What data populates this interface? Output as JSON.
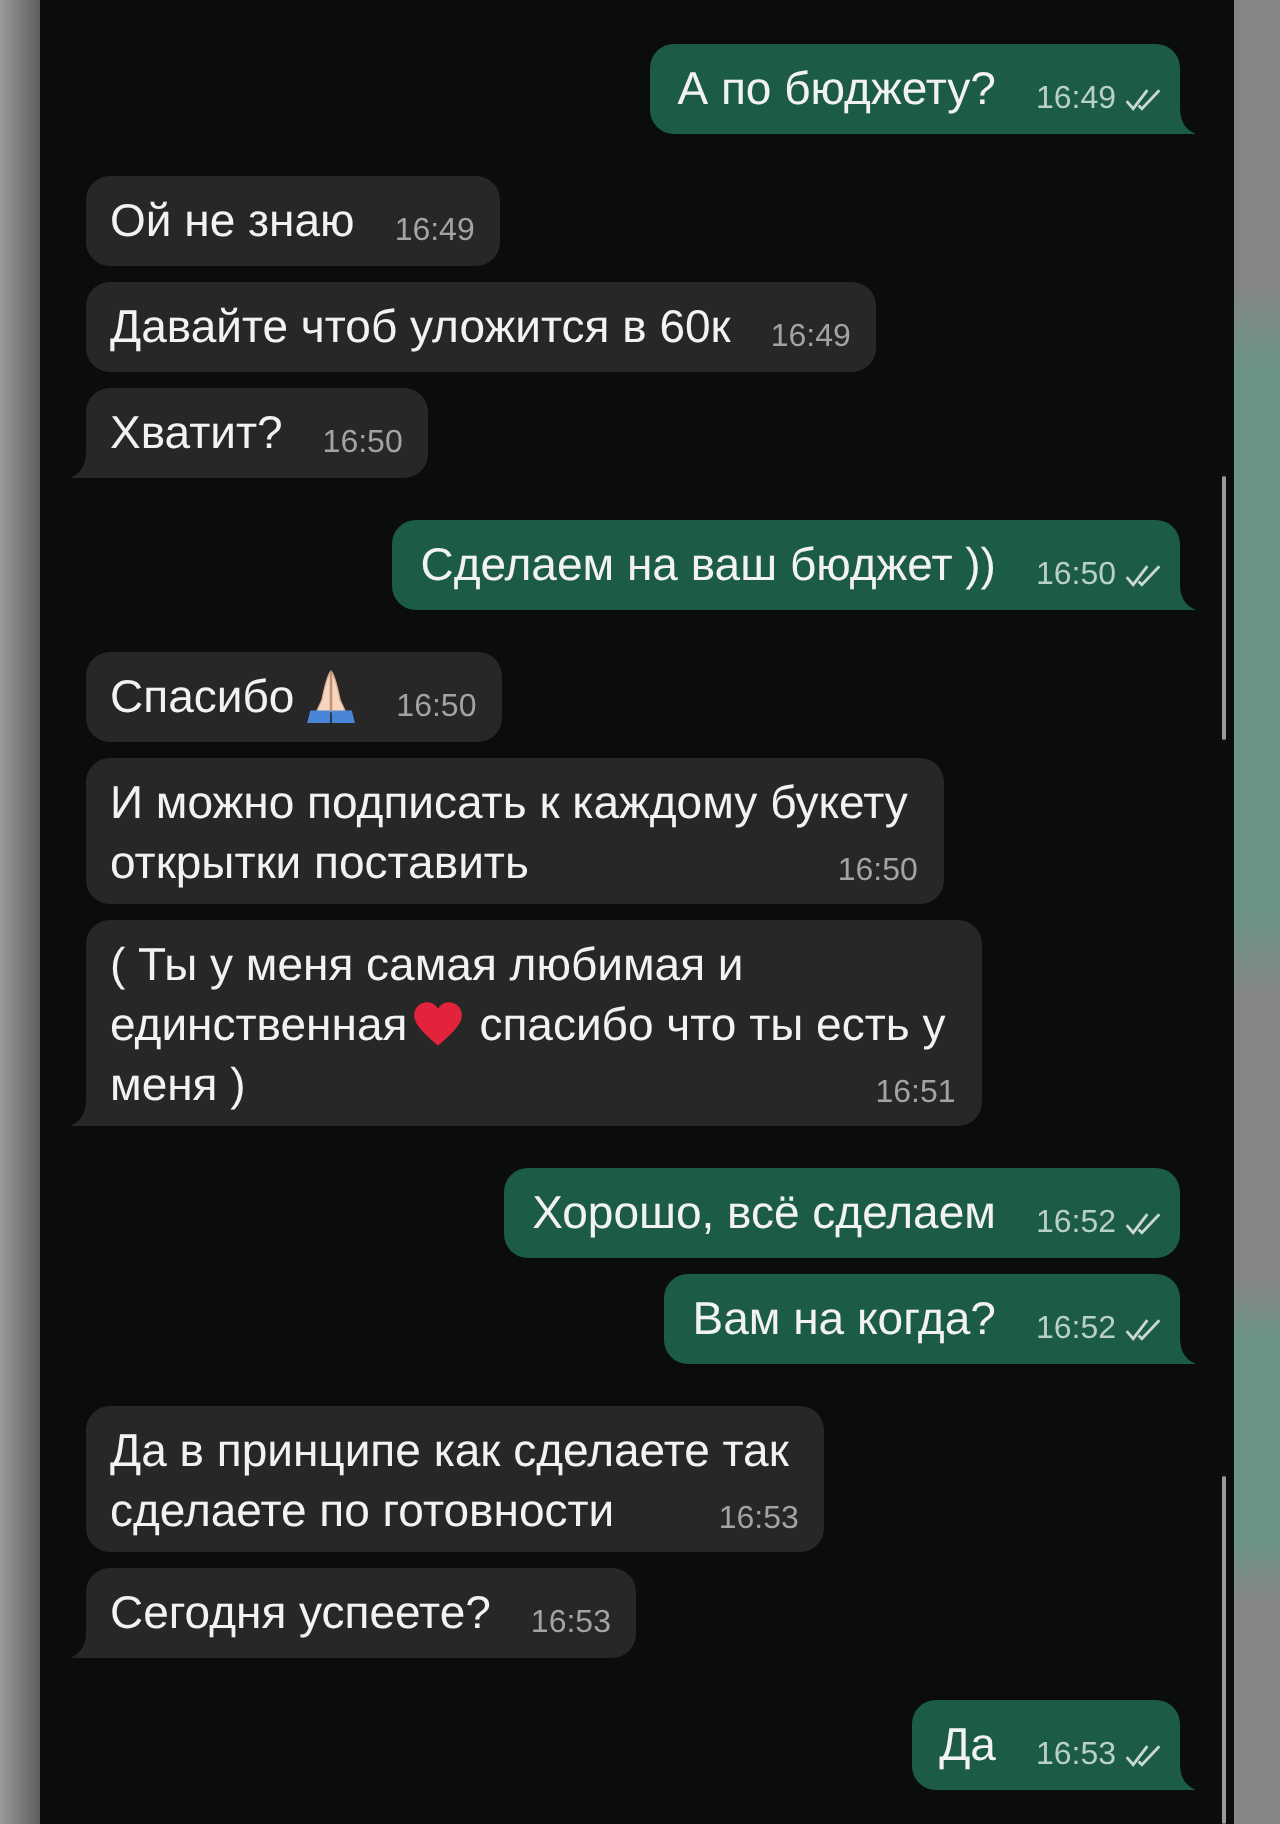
{
  "messages": [
    {
      "kind": "outgoing",
      "tail": true,
      "rows": [
        [
          {
            "kind": "text",
            "text": "А по бюджету?"
          }
        ]
      ],
      "time": "16:49",
      "read": false
    },
    {
      "kind": "incoming",
      "tail": false,
      "rows": [
        [
          {
            "kind": "text",
            "text": "Ой не знаю"
          }
        ]
      ],
      "time": "16:49"
    },
    {
      "kind": "incoming",
      "tail": false,
      "rows": [
        [
          {
            "kind": "text",
            "text": "Давайте чтоб уложится в 60к"
          }
        ]
      ],
      "time": "16:49"
    },
    {
      "kind": "incoming",
      "tail": true,
      "rows": [
        [
          {
            "kind": "text",
            "text": "Хватит?"
          }
        ]
      ],
      "time": "16:50"
    },
    {
      "kind": "outgoing",
      "tail": true,
      "rows": [
        [
          {
            "kind": "text",
            "text": "Сделаем на ваш бюджет ))"
          }
        ]
      ],
      "time": "16:50",
      "read": false
    },
    {
      "kind": "incoming",
      "tail": false,
      "rows": [
        [
          {
            "kind": "text",
            "text": "Спасибо"
          },
          {
            "kind": "pray"
          }
        ]
      ],
      "time": "16:50"
    },
    {
      "kind": "incoming",
      "tail": false,
      "rows": [
        [
          {
            "kind": "text",
            "text": "И можно подписать к каждому букету"
          }
        ],
        [
          {
            "kind": "text",
            "text": "открытки поставить"
          }
        ]
      ],
      "time": "16:50"
    },
    {
      "kind": "incoming",
      "tail": true,
      "rows": [
        [
          {
            "kind": "text",
            "text": "( Ты у меня самая любимая и"
          }
        ],
        [
          {
            "kind": "text",
            "text": "единственная"
          },
          {
            "kind": "heart"
          },
          {
            "kind": "text",
            "text": "спасибо что ты есть у"
          }
        ],
        [
          {
            "kind": "text",
            "text": "меня )"
          }
        ]
      ],
      "time": "16:51"
    },
    {
      "kind": "outgoing",
      "tail": false,
      "rows": [
        [
          {
            "kind": "text",
            "text": "Хорошо, всё сделаем"
          }
        ]
      ],
      "time": "16:52",
      "read": false
    },
    {
      "kind": "outgoing",
      "tail": true,
      "rows": [
        [
          {
            "kind": "text",
            "text": "Вам на когда?"
          }
        ]
      ],
      "time": "16:52",
      "read": false
    },
    {
      "kind": "incoming",
      "tail": false,
      "rows": [
        [
          {
            "kind": "text",
            "text": "Да в принципе как сделаете так"
          }
        ],
        [
          {
            "kind": "text",
            "text": "сделаете по готовности"
          }
        ]
      ],
      "time": "16:53"
    },
    {
      "kind": "incoming",
      "tail": true,
      "rows": [
        [
          {
            "kind": "text",
            "text": "Сегодня успеете?"
          }
        ]
      ],
      "time": "16:53"
    },
    {
      "kind": "outgoing",
      "tail": true,
      "rows": [
        [
          {
            "kind": "text",
            "text": "Да"
          }
        ]
      ],
      "time": "16:53",
      "read": false
    }
  ]
}
